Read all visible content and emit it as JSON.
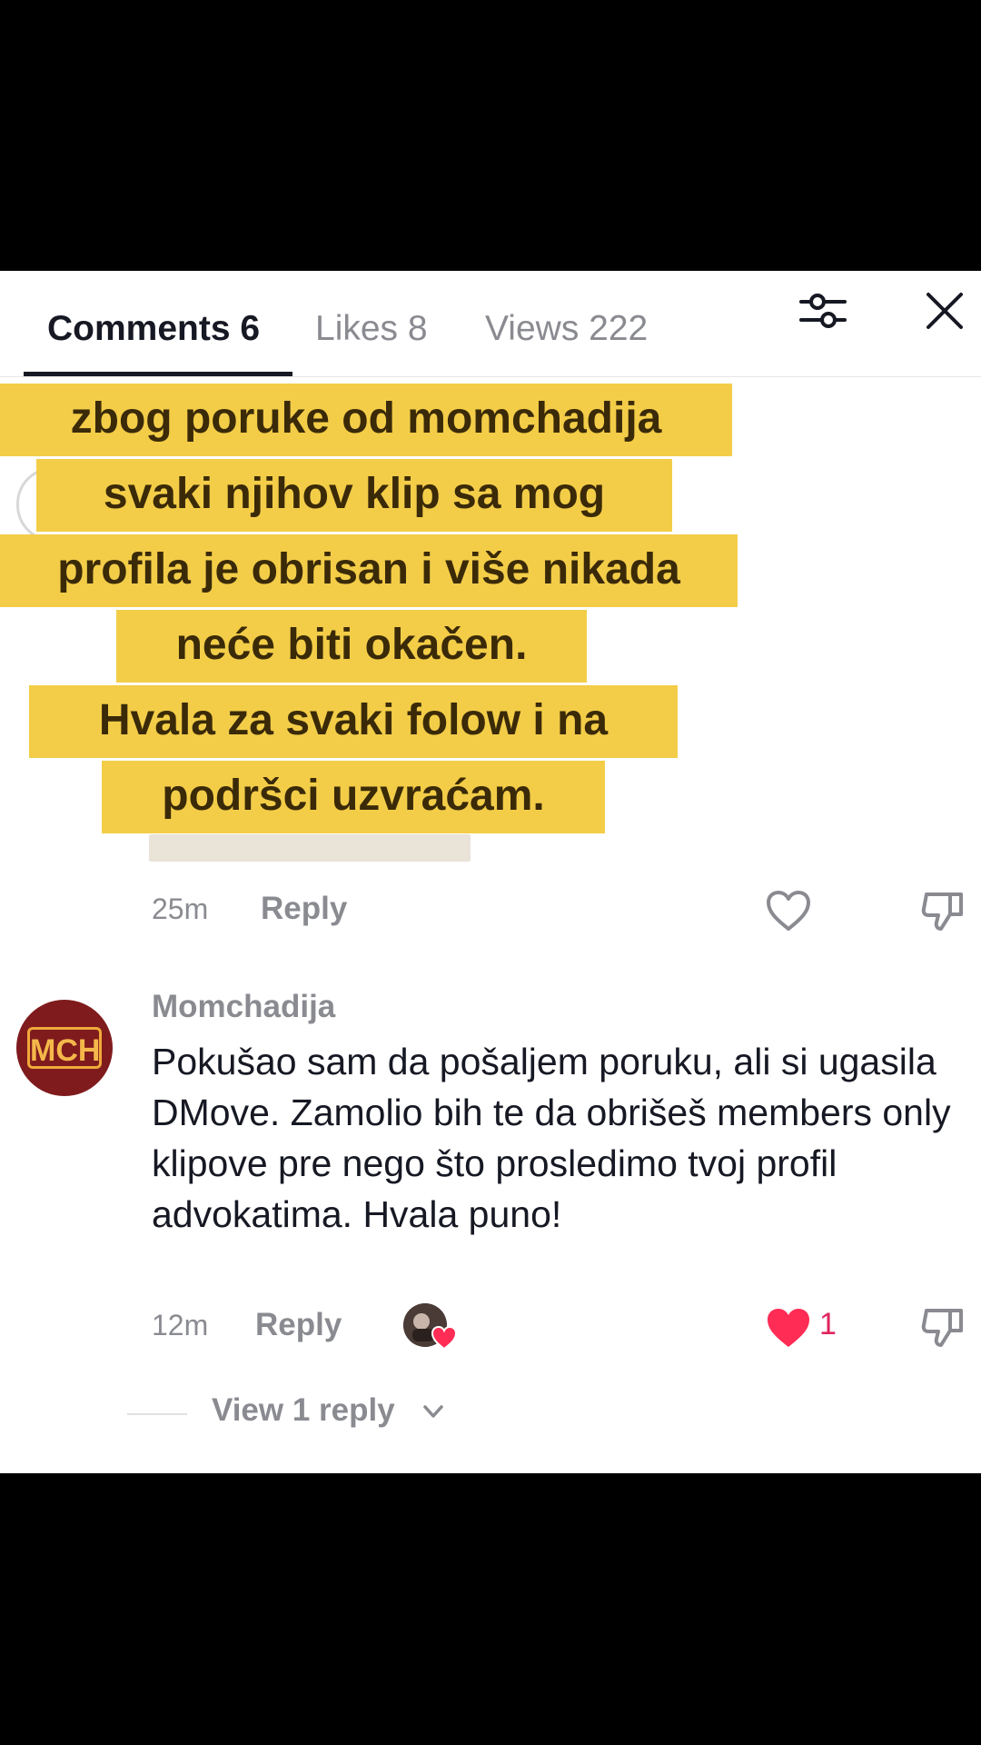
{
  "tabs": {
    "comments": "Comments 6",
    "likes": "Likes 8",
    "views": "Views 222"
  },
  "overlay_lines": [
    "zbog poruke od momchadija",
    "svaki njihov klip sa mog",
    "profila je obrisan i više nikada",
    "neće biti okačen.",
    "Hvala za svaki folow i na",
    "podršci uzvraćam."
  ],
  "first_comment": {
    "time": "25m",
    "reply_label": "Reply"
  },
  "second_comment": {
    "username": "Momchadija",
    "avatar_text": "MCH",
    "text": "Pokušao sam da pošaljem poruku, ali si ugasila DMove. Zamolio bih te da obrišeš members only klipove pre nego što prosledimo tvoj profil advokatima. Hvala puno!",
    "time": "12m",
    "reply_label": "Reply",
    "like_count": "1",
    "view_replies": "View 1 reply"
  },
  "icons": [
    "filter-icon",
    "close-icon",
    "heart-icon",
    "dislike-icon",
    "chevron-down-icon"
  ],
  "colors": {
    "overlay_bg": "#f3cd48",
    "avatar_bg": "#7f1b1d",
    "like_red": "#e0245e"
  }
}
